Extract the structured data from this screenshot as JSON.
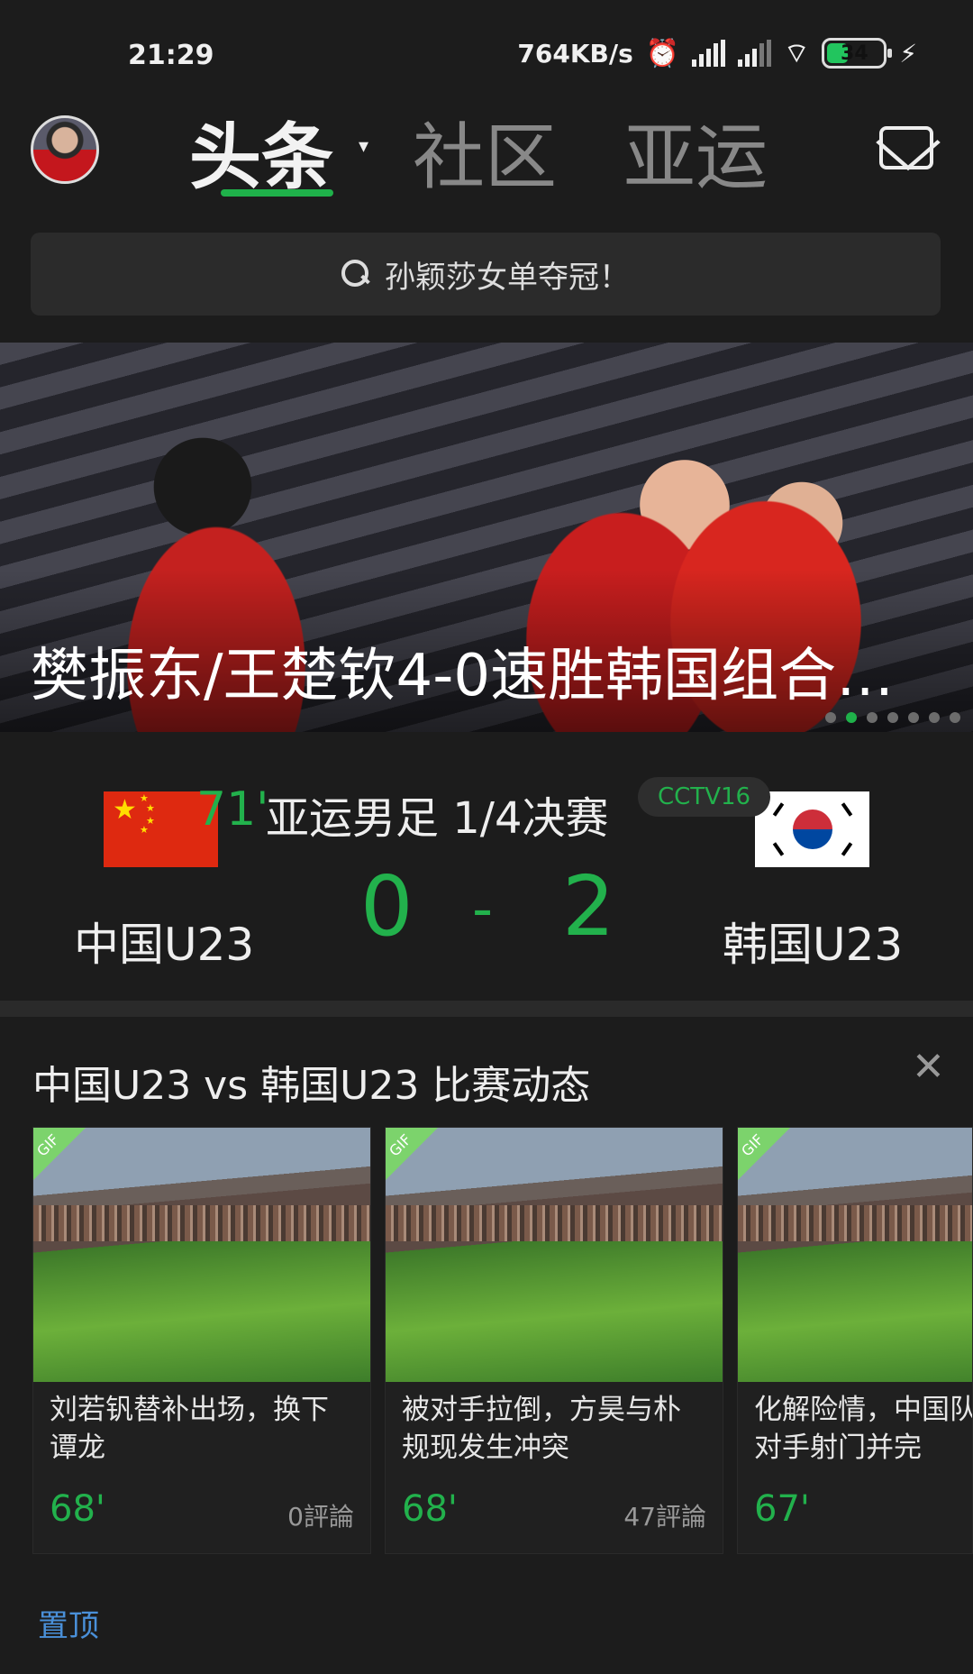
{
  "status_bar": {
    "time": "21:29",
    "network_speed": "764KB/s",
    "battery_level": "34"
  },
  "top_nav": {
    "tabs": [
      {
        "label": "头条",
        "active": true
      },
      {
        "label": "社区",
        "active": false
      },
      {
        "label": "亚运",
        "active": false
      }
    ]
  },
  "search": {
    "placeholder": "孙颖莎女单夺冠！"
  },
  "banner": {
    "title": "樊振东/王楚钦4-0速胜韩国组合…",
    "slide_count": 7,
    "active_slide": 2
  },
  "match": {
    "minute": "71'",
    "round": "亚运男足 1/4决赛",
    "channel": "CCTV16",
    "home_team": "中国U23",
    "away_team": "韩国U23",
    "home_score": "0",
    "separator": "-",
    "away_score": "2"
  },
  "feed": {
    "title": "中国U23 vs 韩国U23 比赛动态",
    "close_icon": "close-icon",
    "cards": [
      {
        "badge": "GIF",
        "title": "刘若钒替补出场，换下谭龙",
        "minute": "68'",
        "comments": "0評論"
      },
      {
        "badge": "GIF",
        "title": "被对手拉倒，方昊与朴规现发生冲突",
        "minute": "68'",
        "comments": "47評論"
      },
      {
        "badge": "GIF",
        "title": "化解险情，中国队封堵对手射门并完",
        "minute": "67'",
        "comments": ""
      }
    ],
    "pin_label": "置顶"
  },
  "colors": {
    "accent_green": "#22b14c",
    "background": "#1c1c1c",
    "link_blue": "#4a90d9"
  }
}
